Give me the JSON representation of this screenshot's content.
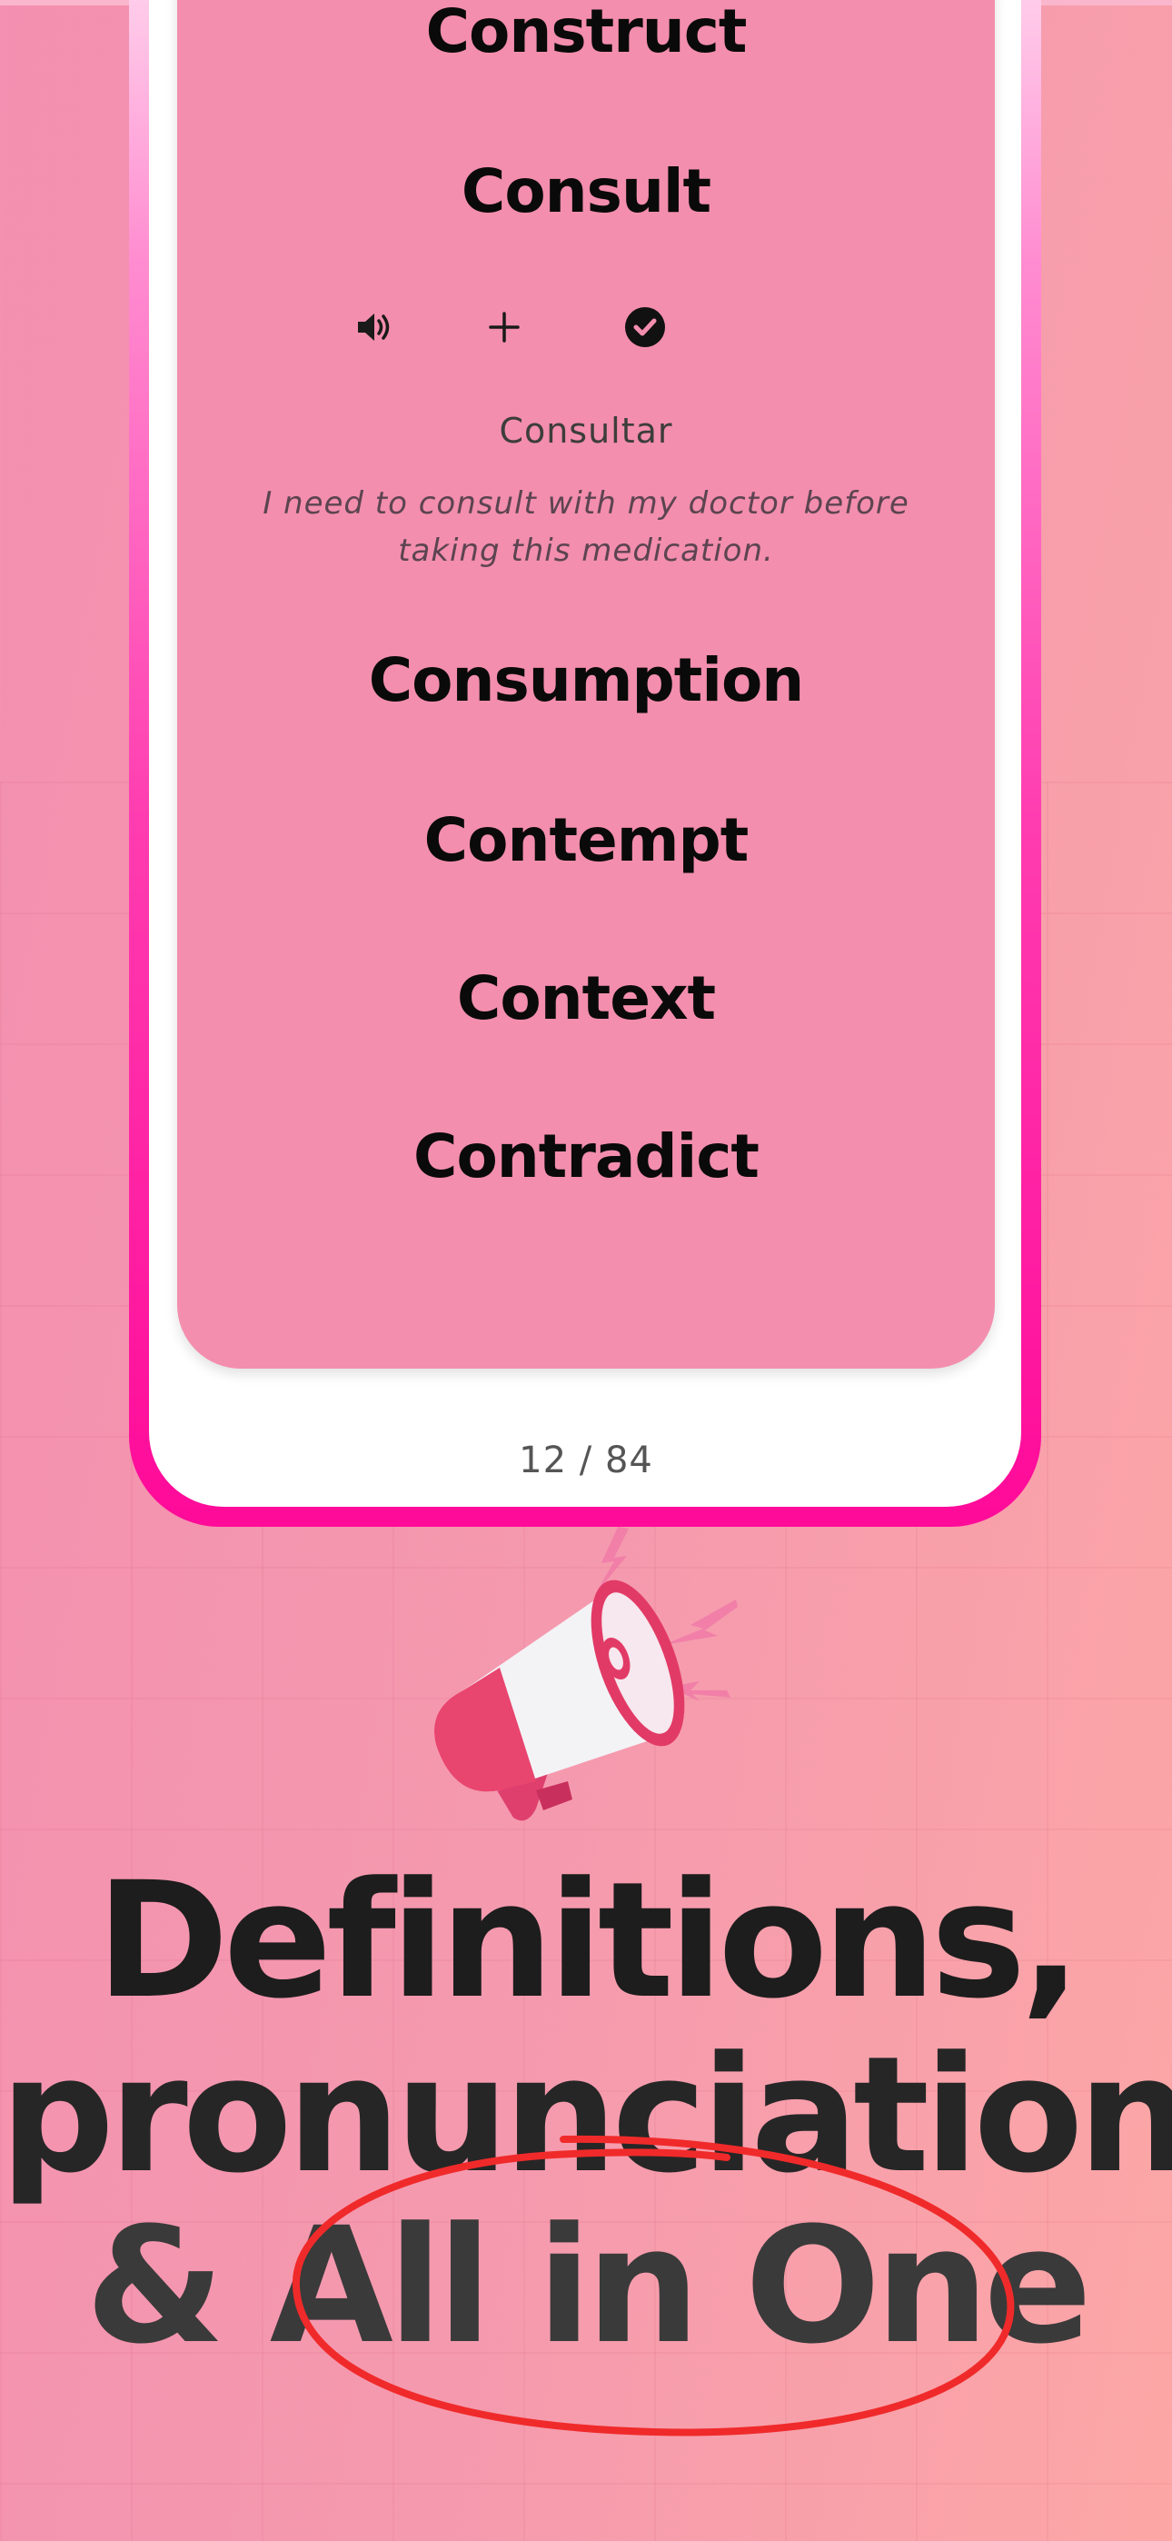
{
  "words": [
    {
      "text": "Construct"
    },
    {
      "text": "Consult"
    },
    {
      "text": "Consumption"
    },
    {
      "text": "Contempt"
    },
    {
      "text": "Context"
    },
    {
      "text": "Contradict"
    }
  ],
  "selected": {
    "translation": "Consultar",
    "example": "I need to consult with my doctor before taking this medication.",
    "actions": [
      {
        "icon": "speaker-icon"
      },
      {
        "icon": "plus-icon"
      },
      {
        "icon": "check-circle-icon"
      }
    ]
  },
  "counter": "12 / 84",
  "headline": {
    "line1": "Definitions,",
    "line2": "pronunciation",
    "line3": "& All in One"
  },
  "colors": {
    "frame_accent": "#ff0a99",
    "card": "#f38eae",
    "circle_stroke": "#f02a2a"
  }
}
